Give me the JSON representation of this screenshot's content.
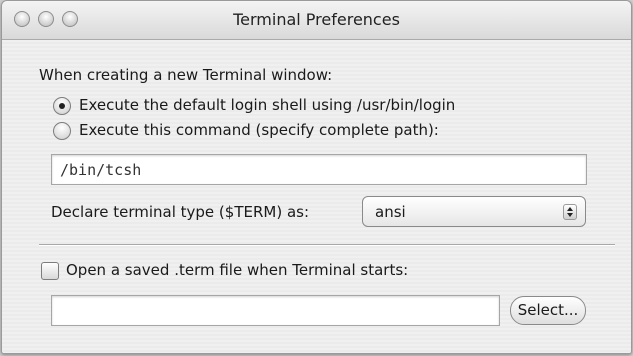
{
  "window": {
    "title": "Terminal Preferences"
  },
  "titlebar": {
    "icons": [
      "close-icon",
      "minimize-icon",
      "zoom-icon"
    ]
  },
  "startup": {
    "heading": "When creating a new Terminal window:",
    "option_default": "Execute the default login shell using /usr/bin/login",
    "option_default_selected": true,
    "option_command": "Execute this command (specify complete path):",
    "option_command_selected": false,
    "command_value": "/bin/tcsh",
    "term_label": "Declare terminal type ($TERM) as:",
    "term_value": "ansi"
  },
  "term_file": {
    "checkbox_label": "Open a saved .term file when Terminal starts:",
    "checked": false,
    "path_value": "",
    "select_label": "Select..."
  }
}
